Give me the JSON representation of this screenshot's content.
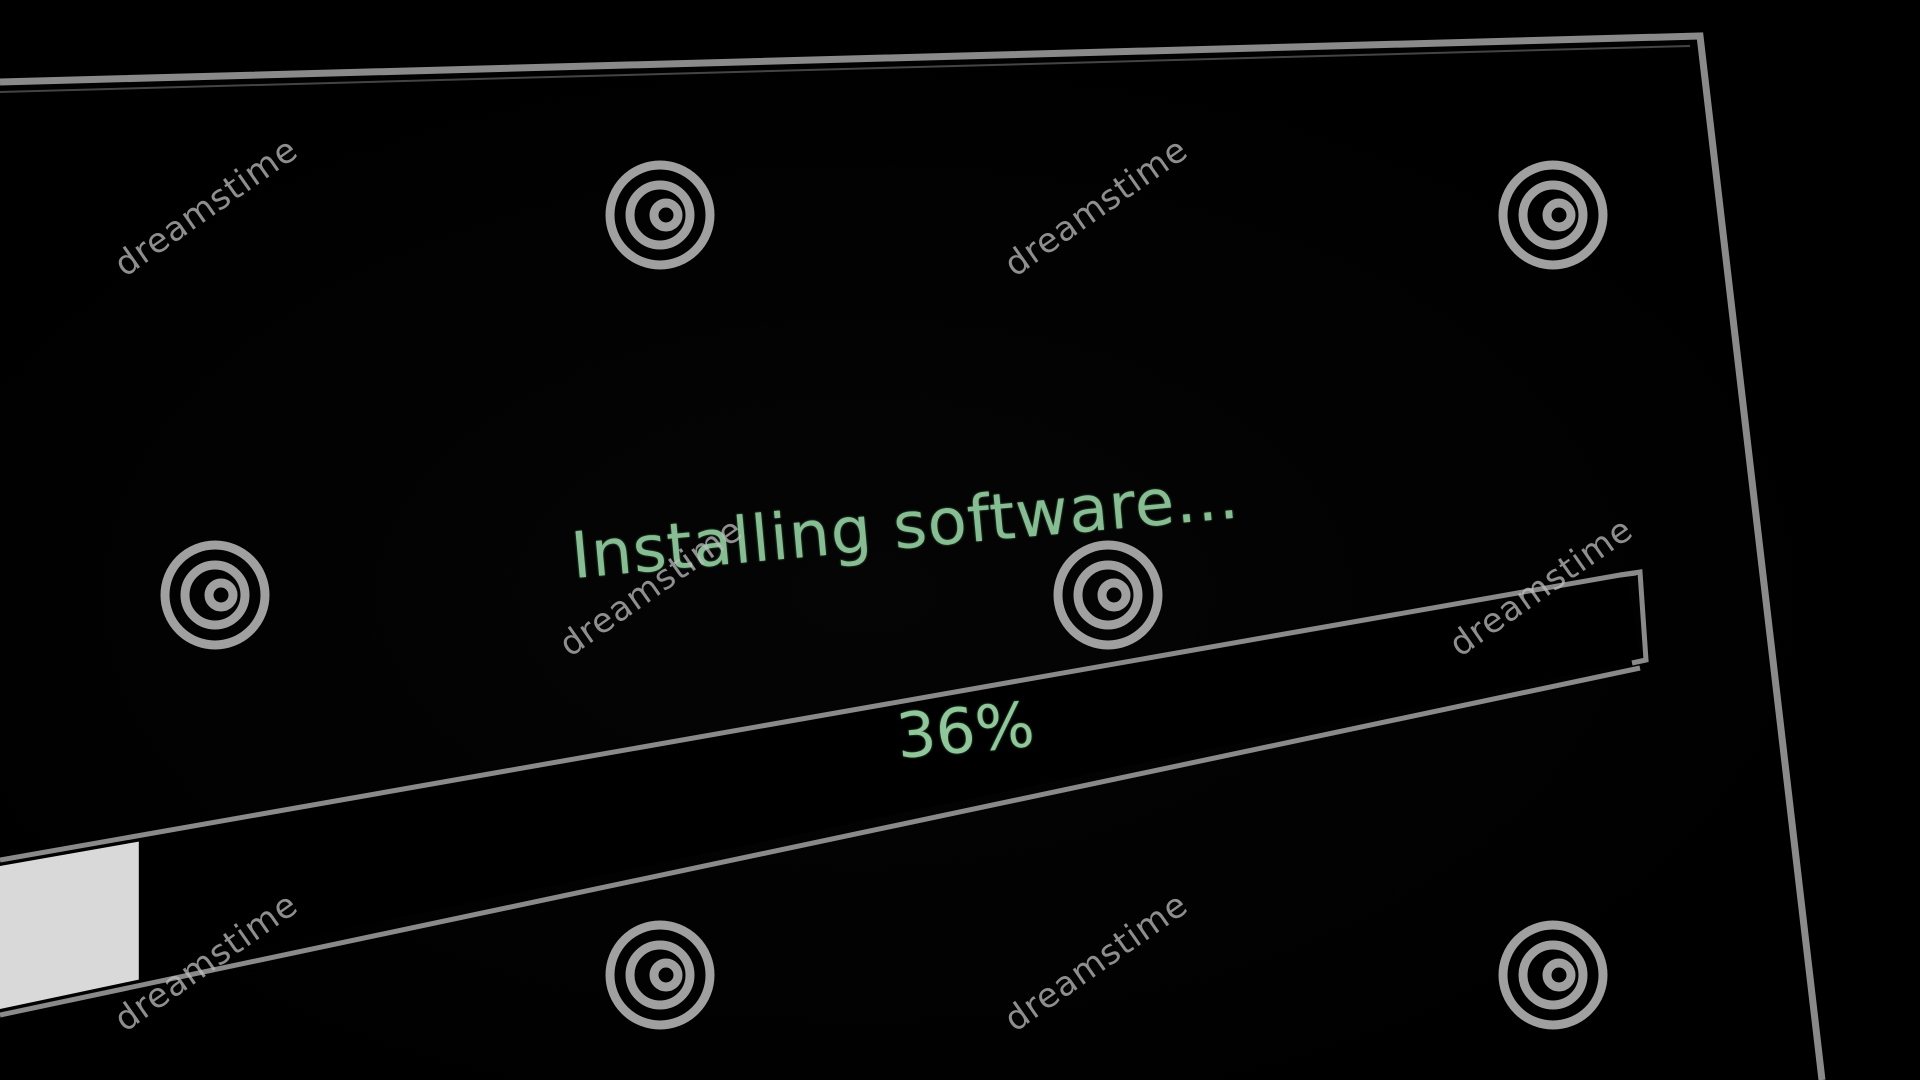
{
  "installer": {
    "status": "Installing software...",
    "progress_label": "36%",
    "progress_fraction": 0.36
  },
  "watermark": {
    "brand": "dreamstime"
  },
  "colors": {
    "background": "#000000",
    "text": "#8fc79a",
    "frame": "#9a9a9a",
    "bar_fill": "#d8d8d8"
  }
}
